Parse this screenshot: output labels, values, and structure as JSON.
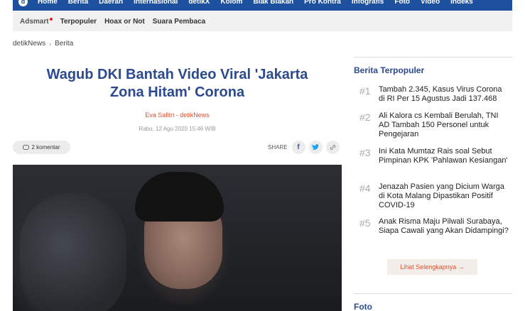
{
  "topnav": {
    "logo": "d",
    "items": [
      "Home",
      "Berita",
      "Daerah",
      "Internasional",
      "detikX",
      "Kolom",
      "Blak Blakan",
      "Pro Kontra",
      "Infografis",
      "Foto",
      "Video",
      "Indeks"
    ]
  },
  "subnav": {
    "items": [
      "Adsmart",
      "Terpopuler",
      "Hoax or Not",
      "Suara Pembaca"
    ]
  },
  "breadcrumb": {
    "home": "detikNews",
    "section": "Berita"
  },
  "article": {
    "title": "Wagub DKI Bantah Video Viral 'Jakarta Zona Hitam' Corona",
    "author": "Eva Safitri - detikNews",
    "date": "Rabu, 12 Agu 2020 15:46 WIB",
    "comments": "2 komentar",
    "share_label": "SHARE"
  },
  "sidebar": {
    "heading": "Berita Terpopuler",
    "items": [
      {
        "num": "#1",
        "text": "Tambah 2.345, Kasus Virus Corona di RI Per 15 Agustus Jadi 137.468"
      },
      {
        "num": "#2",
        "text": "Ali Kalora cs Kembali Berulah, TNI AD Tambah 150 Personel untuk Pengejaran"
      },
      {
        "num": "#3",
        "text": "Ini Kata Mumtaz Rais soal Sebut Pimpinan KPK 'Pahlawan Kesiangan'"
      },
      {
        "num": "#4",
        "text": "Jenazah Pasien yang Dicium Warga di Kota Malang Dipastikan Positif COVID-19"
      },
      {
        "num": "#5",
        "text": "Anak Risma Maju Pilwali Surabaya, Siapa Cawali yang Akan Didampingi?"
      }
    ],
    "see_more": "Lihat Selengkapnya →",
    "foto_heading": "Foto"
  }
}
